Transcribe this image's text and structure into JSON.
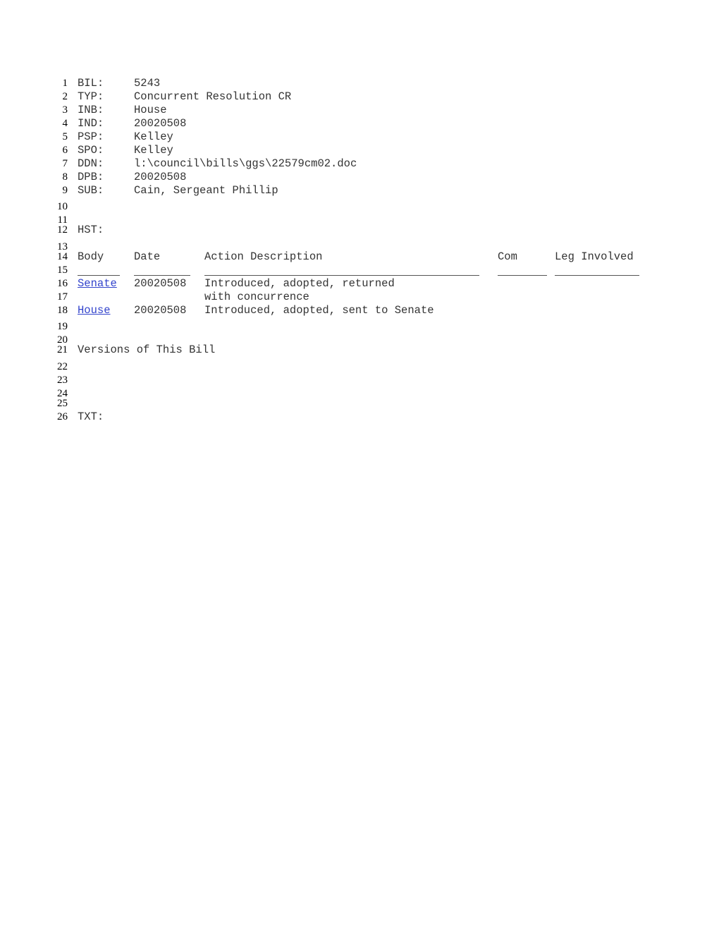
{
  "line_numbers": [
    "1",
    "2",
    "3",
    "4",
    "5",
    "6",
    "7",
    "8",
    "9",
    "10",
    "11",
    "12",
    "13",
    "14",
    "15",
    "16",
    "17",
    "18",
    "19",
    "20",
    "21",
    "22",
    "23",
    "24",
    "25",
    "26"
  ],
  "fields": [
    {
      "key": "BIL:",
      "value": "5243"
    },
    {
      "key": "TYP:",
      "value": "Concurrent Resolution CR"
    },
    {
      "key": "INB:",
      "value": "House"
    },
    {
      "key": "IND:",
      "value": "20020508"
    },
    {
      "key": "PSP:",
      "value": "Kelley"
    },
    {
      "key": "SPO:",
      "value": "Kelley"
    },
    {
      "key": "DDN:",
      "value": "l:\\council\\bills\\ggs\\22579cm02.doc"
    },
    {
      "key": "DPB:",
      "value": "20020508"
    },
    {
      "key": "SUB:",
      "value": "Cain, Sergeant Phillip"
    }
  ],
  "history": {
    "label": "HST:",
    "columns": [
      "Body",
      "Date",
      "Action Description",
      "Com",
      "Leg Involved"
    ],
    "rows": [
      {
        "body": "Senate",
        "date": "20020508",
        "action": "Introduced, adopted, returned",
        "action_cont": "with concurrence"
      },
      {
        "body": "House",
        "date": "20020508",
        "action": "Introduced, adopted, sent to Senate"
      }
    ]
  },
  "versions_label": "Versions of This Bill",
  "text_label": "TXT:",
  "colors": {
    "link": "#3344cc"
  }
}
